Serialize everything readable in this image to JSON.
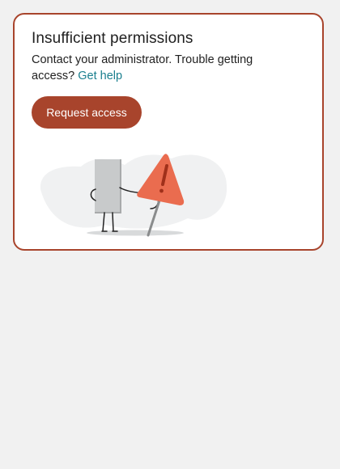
{
  "dialog": {
    "title": "Insufficient permissions",
    "message": "Contact your administrator. Trouble getting access?",
    "help_link": "Get help",
    "request_button": "Request access"
  },
  "illustration": {
    "name": "document-holding-warning-sign",
    "icon": "warning-icon"
  },
  "colors": {
    "accent": "#a8442c",
    "link": "#1a7f8e",
    "warning": "#ea6c4f",
    "page_background": "#f1f1f1"
  }
}
